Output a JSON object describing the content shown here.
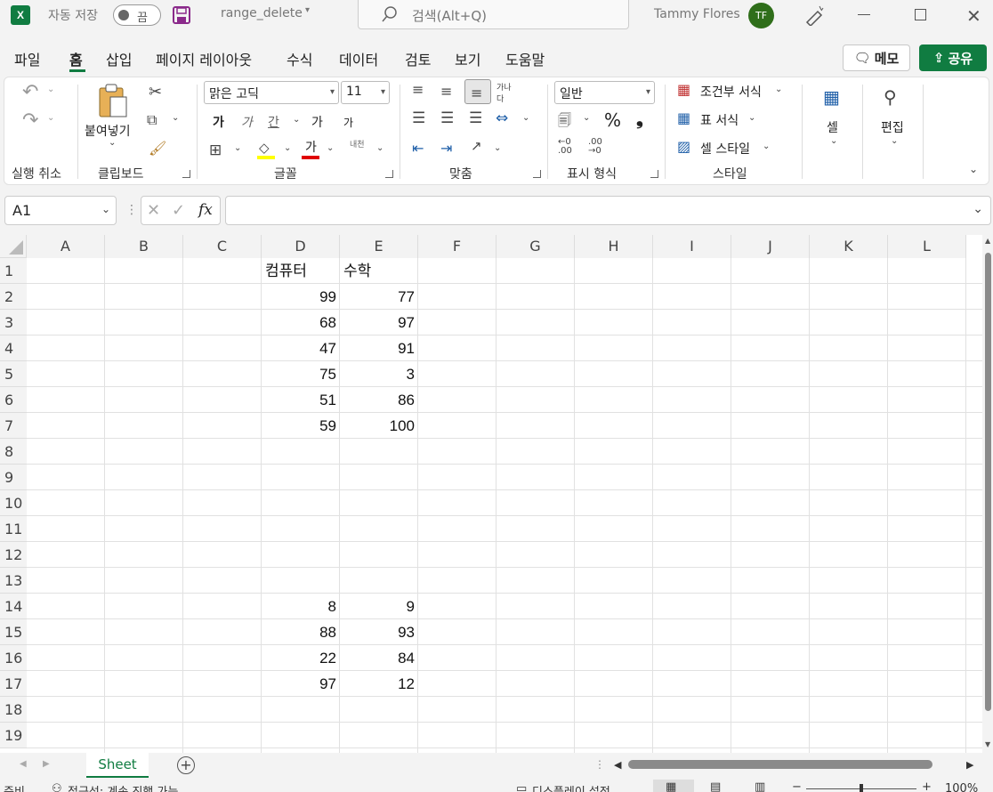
{
  "titlebar": {
    "app_letter": "X",
    "autosave_label": "자동 저장",
    "autosave_state": "끔",
    "filename": "range_delete",
    "search_placeholder": "검색(Alt+Q)",
    "user_name": "Tammy Flores",
    "user_initials": "TF"
  },
  "menu": {
    "tabs": [
      "파일",
      "홈",
      "삽입",
      "페이지 레이아웃",
      "수식",
      "데이터",
      "검토",
      "보기",
      "도움말"
    ],
    "active_tab": "홈",
    "memo_label": "메모",
    "share_label": "공유"
  },
  "ribbon": {
    "undo_group": "실행 취소",
    "clipboard_group": "클립보드",
    "paste_label": "붙여넣기",
    "font_group": "글꼴",
    "font_name": "맑은 고딕",
    "font_size": "11",
    "bold": "가",
    "italic": "가",
    "underline": "간",
    "grow": "가",
    "shrink": "가",
    "font_color_letter": "가",
    "phonetic": "내천",
    "align_group": "맞춤",
    "number_group": "표시 형식",
    "number_format": "일반",
    "percent": "%",
    "comma": "❟",
    "styles_group": "스타일",
    "conditional_format": "조건부 서식",
    "table_format": "표 서식",
    "cell_style": "셀 스타일",
    "cells_label": "셀",
    "edit_label": "편집",
    "colors": {
      "fill_bar": "#ffff00",
      "font_bar": "#e00000"
    }
  },
  "formula_bar": {
    "name_box": "A1",
    "fx": "fx",
    "value": ""
  },
  "grid": {
    "columns": [
      "A",
      "B",
      "C",
      "D",
      "E",
      "F",
      "G",
      "H",
      "I",
      "J",
      "K",
      "L"
    ],
    "rows": [
      "1",
      "2",
      "3",
      "4",
      "5",
      "6",
      "7",
      "8",
      "9",
      "10",
      "11",
      "12",
      "13",
      "14",
      "15",
      "16",
      "17",
      "18",
      "19"
    ],
    "headers": {
      "D1": "컴퓨터",
      "E1": "수학"
    },
    "values": [
      {
        "row": 2,
        "D": "99",
        "E": "77"
      },
      {
        "row": 3,
        "D": "68",
        "E": "97"
      },
      {
        "row": 4,
        "D": "47",
        "E": "91"
      },
      {
        "row": 5,
        "D": "75",
        "E": "3"
      },
      {
        "row": 6,
        "D": "51",
        "E": "86"
      },
      {
        "row": 7,
        "D": "59",
        "E": "100"
      },
      {
        "row": 14,
        "D": "8",
        "E": "9"
      },
      {
        "row": 15,
        "D": "88",
        "E": "93"
      },
      {
        "row": 16,
        "D": "22",
        "E": "84"
      },
      {
        "row": 17,
        "D": "97",
        "E": "12"
      }
    ]
  },
  "sheets": {
    "tabs": [
      "Sheet"
    ],
    "active": "Sheet"
  },
  "status": {
    "ready": "준비",
    "accessibility": "접근성: 계속 진행 가능",
    "display_settings": "디스플레이 설정",
    "zoom": "100%"
  }
}
